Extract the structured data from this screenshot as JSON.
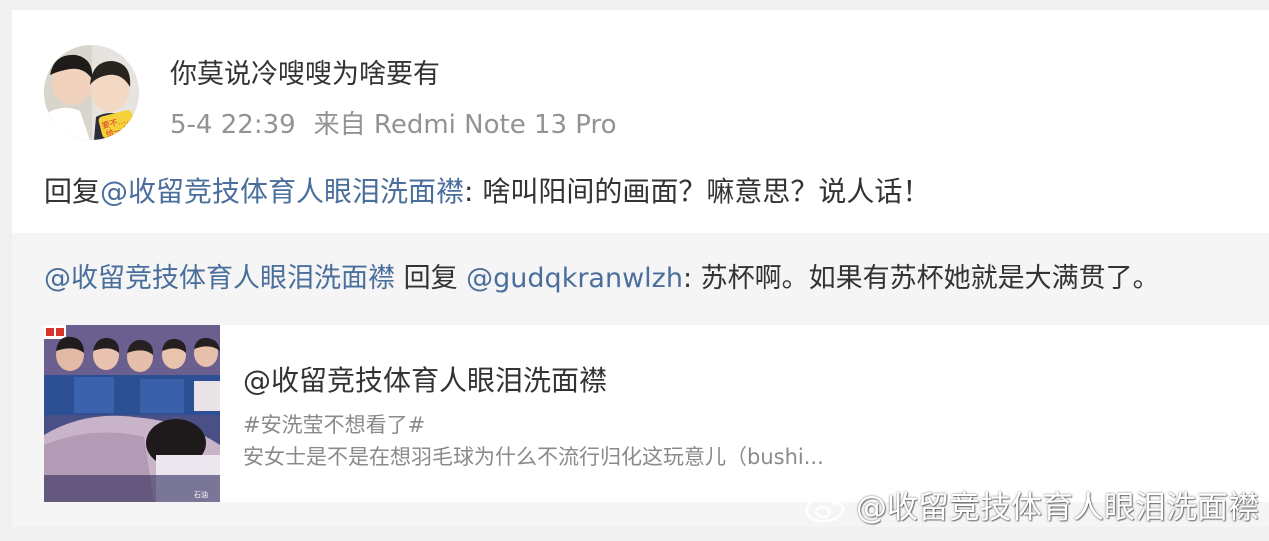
{
  "post": {
    "username": "你莫说冷嗖嗖为啥要有",
    "time": "5-4 22:39",
    "source": "来自 Redmi Note 13 Pro",
    "reply_prefix": "回复",
    "reply_mention": "@收留竞技体育人眼泪洗面襟",
    "reply_body": ": 啥叫阳间的画面？嘛意思？说人话！"
  },
  "quote": {
    "author_mention": "@收留竞技体育人眼泪洗面襟",
    "reply_word": " 回复 ",
    "target_mention": "@gudqkranwlzh",
    "body": ": 苏杯啊。如果有苏杯她就是大满贯了。"
  },
  "link_card": {
    "title": "@收留竞技体育人眼泪洗面襟",
    "tag": "#安洗莹不想看了#",
    "description": "安女士是不是在想羽毛球为什么不流行归化这玩意儿（bushi..."
  },
  "watermark": {
    "text": "@收留竞技体育人眼泪洗面襟",
    "icon": "weibo-logo-icon"
  },
  "colors": {
    "mention": "#4a6f9c",
    "text": "#333333",
    "meta": "#939393",
    "card_bg": "#ffffff",
    "quote_bg": "#f5f5f5",
    "page_bg": "#f0f0f0"
  }
}
